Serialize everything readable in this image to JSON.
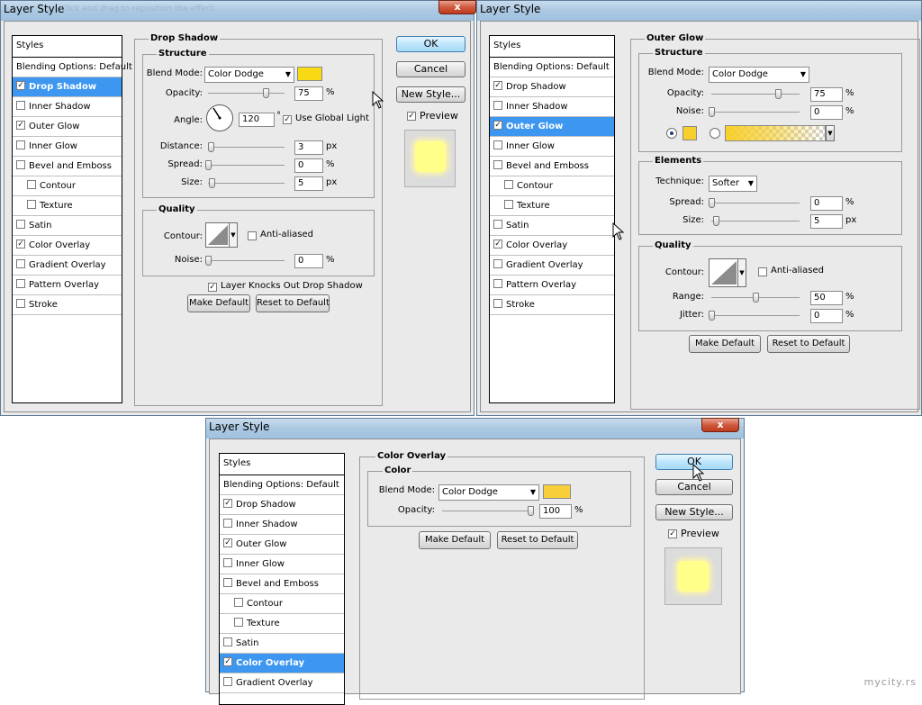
{
  "window_title": "Layer Style",
  "faint_title_text": "Click and drag to reposition the effect.",
  "close_glyph": "x",
  "watermark": "mycity.rs",
  "percent_unit": "%",
  "px_unit": "px",
  "check_glyph": "✓",
  "styles_list": {
    "header": "Styles",
    "items": [
      "Blending Options: Default",
      "Drop Shadow",
      "Inner Shadow",
      "Outer Glow",
      "Inner Glow",
      "Bevel and Emboss",
      "Contour",
      "Texture",
      "Satin",
      "Color Overlay",
      "Gradient Overlay",
      "Pattern Overlay",
      "Stroke"
    ]
  },
  "buttons": {
    "ok": "OK",
    "cancel": "Cancel",
    "new_style": "New Style...",
    "preview": "Preview",
    "make_default": "Make Default",
    "reset_to_default": "Reset to Default"
  },
  "drop_shadow": {
    "title": "Drop Shadow",
    "structure_title": "Structure",
    "blend_mode_label": "Blend Mode:",
    "blend_mode_value": "Color Dodge",
    "opacity_label": "Opacity:",
    "opacity_value": "75",
    "opacity_fraction": 0.75,
    "angle_label": "Angle:",
    "angle_value": "120",
    "angle_unit": "°",
    "use_global_light": "Use Global Light",
    "distance_label": "Distance:",
    "distance_value": "3",
    "spread_label": "Spread:",
    "spread_value": "0",
    "size_label": "Size:",
    "size_value": "5",
    "quality_title": "Quality",
    "contour_label": "Contour:",
    "anti_aliased": "Anti-aliased",
    "noise_label": "Noise:",
    "noise_value": "0",
    "layer_knocks_out": "Layer Knocks Out Drop Shadow",
    "color": "#f7d914"
  },
  "outer_glow": {
    "title": "Outer Glow",
    "structure_title": "Structure",
    "blend_mode_label": "Blend Mode:",
    "blend_mode_value": "Color Dodge",
    "opacity_label": "Opacity:",
    "opacity_value": "75",
    "noise_label": "Noise:",
    "noise_value": "0",
    "elements_title": "Elements",
    "technique_label": "Technique:",
    "technique_value": "Softer",
    "spread_label": "Spread:",
    "spread_value": "0",
    "size_label": "Size:",
    "size_value": "5",
    "quality_title": "Quality",
    "contour_label": "Contour:",
    "anti_aliased": "Anti-aliased",
    "range_label": "Range:",
    "range_value": "50",
    "jitter_label": "Jitter:",
    "jitter_value": "0",
    "color": "#f8cf2a"
  },
  "color_overlay": {
    "title": "Color Overlay",
    "color_title": "Color",
    "blend_mode_label": "Blend Mode:",
    "blend_mode_value": "Color Dodge",
    "opacity_label": "Opacity:",
    "opacity_value": "100",
    "color": "#f8cf3a"
  }
}
